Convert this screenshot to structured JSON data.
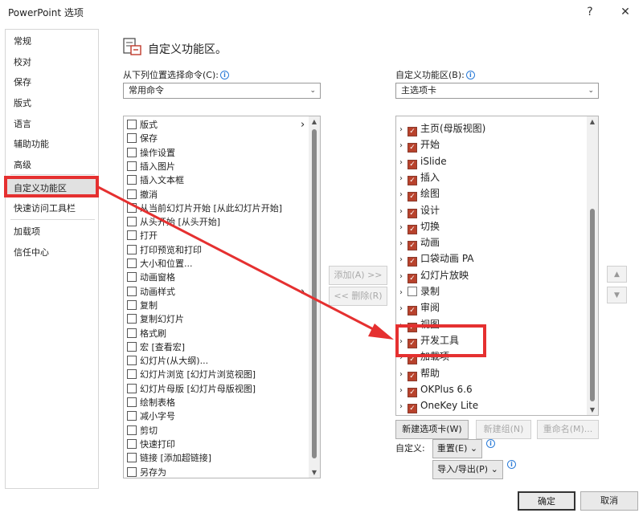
{
  "window": {
    "title": "PowerPoint 选项",
    "help": "?",
    "close": "✕"
  },
  "nav": {
    "items": [
      "常规",
      "校对",
      "保存",
      "版式",
      "语言",
      "辅助功能",
      "高级",
      "自定义功能区",
      "快速访问工具栏",
      "加载项",
      "信任中心"
    ],
    "selected": "自定义功能区"
  },
  "header": {
    "title": "自定义功能区。"
  },
  "left": {
    "label": "从下列位置选择命令(C):",
    "combo_value": "常用命令",
    "commands": [
      "版式",
      "保存",
      "操作设置",
      "插入图片",
      "插入文本框",
      "撤消",
      "从当前幻灯片开始 [从此幻灯片开始]",
      "从头开始 [从头开始]",
      "打开",
      "打印预览和打印",
      "大小和位置...",
      "动画窗格",
      "动画样式",
      "复制",
      "复制幻灯片",
      "格式刷",
      "宏 [查看宏]",
      "幻灯片(从大纲)...",
      "幻灯片浏览 [幻灯片浏览视图]",
      "幻灯片母版 [幻灯片母版视图]",
      "绘制表格",
      "减小字号",
      "剪切",
      "快速打印",
      "链接 [添加超链接]",
      "另存为"
    ]
  },
  "middle": {
    "add": "添加(A) >>",
    "remove": "<< 删除(R)"
  },
  "right": {
    "label": "自定义功能区(B):",
    "combo_value": "主选项卡",
    "tabs": [
      {
        "label": "主页(母版视图)",
        "checked": true
      },
      {
        "label": "开始",
        "checked": true
      },
      {
        "label": "iSlide",
        "checked": true
      },
      {
        "label": "插入",
        "checked": true
      },
      {
        "label": "绘图",
        "checked": true
      },
      {
        "label": "设计",
        "checked": true
      },
      {
        "label": "切换",
        "checked": true
      },
      {
        "label": "动画",
        "checked": true
      },
      {
        "label": "口袋动画 PA",
        "checked": true
      },
      {
        "label": "幻灯片放映",
        "checked": true
      },
      {
        "label": "录制",
        "checked": false
      },
      {
        "label": "审阅",
        "checked": true
      },
      {
        "label": "视图",
        "checked": true
      },
      {
        "label": "开发工具",
        "checked": true
      },
      {
        "label": "加载项",
        "checked": true
      },
      {
        "label": "帮助",
        "checked": true
      },
      {
        "label": "OKPlus 6.6",
        "checked": true
      },
      {
        "label": "OneKey Lite",
        "checked": true
      }
    ],
    "new_tab": "新建选项卡(W)",
    "new_group": "新建组(N)",
    "rename": "重命名(M)...",
    "customize_label": "自定义:",
    "reset": "重置(E)",
    "import_export": "导入/导出(P)"
  },
  "footer": {
    "ok": "确定",
    "cancel": "取消"
  },
  "colors": {
    "highlight": "#e53030",
    "checkbox": "#b8422c"
  }
}
